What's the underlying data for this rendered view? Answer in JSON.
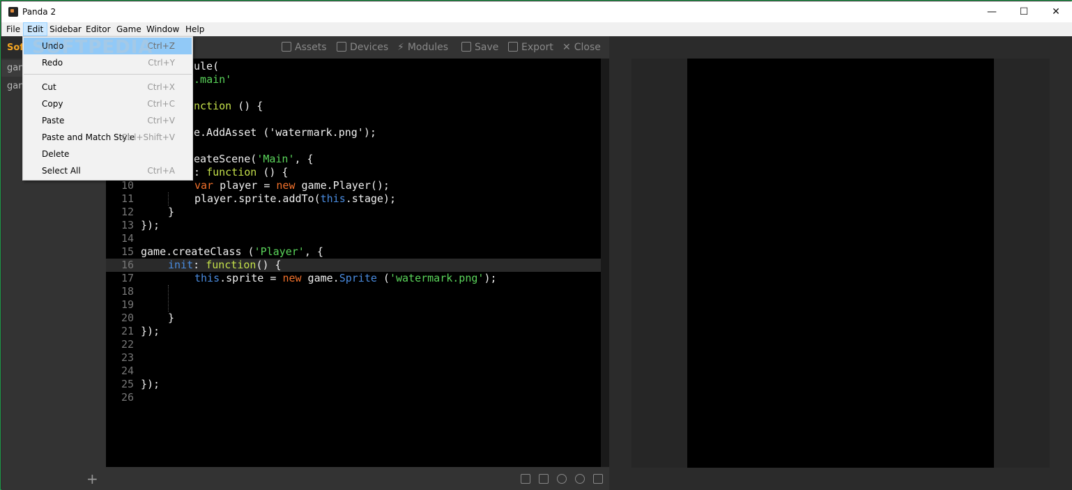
{
  "window": {
    "title": "Panda 2",
    "minimize": "—",
    "maximize": "☐",
    "close": "✕"
  },
  "menubar": {
    "items": [
      "File",
      "Edit",
      "Sidebar",
      "Editor",
      "Game",
      "Window",
      "Help"
    ]
  },
  "sidebar": {
    "title": "Sof",
    "items": [
      "gan",
      "gan"
    ],
    "add": "+"
  },
  "toolbar": {
    "assets": "Assets",
    "devices": "Devices",
    "modules": "Modules",
    "save": "Save",
    "export": "Export",
    "close": "Close"
  },
  "edit_menu": {
    "items": [
      {
        "label": "Undo",
        "shortcut": "Ctrl+Z"
      },
      {
        "label": "Redo",
        "shortcut": "Ctrl+Y"
      },
      {
        "label": "Cut",
        "shortcut": "Ctrl+X"
      },
      {
        "label": "Copy",
        "shortcut": "Ctrl+C"
      },
      {
        "label": "Paste",
        "shortcut": "Ctrl+V"
      },
      {
        "label": "Paste and Match Style",
        "shortcut": "Ctrl+Shift+V"
      },
      {
        "label": "Delete",
        "shortcut": ""
      },
      {
        "label": "Select All",
        "shortcut": "Ctrl+A"
      }
    ]
  },
  "code": {
    "l1": "ule(",
    "l2": "e.main'",
    "l4a": "nction",
    "l4b": "() {",
    "l6": "e.AddAsset ('watermark.png');",
    "l8a": "eateScene(",
    "l8b": "'Main'",
    "l8c": ", {",
    "l9a": ": ",
    "l9b": "function",
    "l9c": " () {",
    "l10a": "var",
    "l10b": " player = ",
    "l10c": "new",
    "l10d": " game.Player();",
    "l11a": "player.sprite.addTo(",
    "l11b": "this",
    "l11c": ".stage);",
    "l12": "}",
    "l13": "});",
    "l15a": "game.createClass (",
    "l15b": "'Player'",
    "l15c": ", {",
    "l16a": "init",
    "l16b": ": ",
    "l16c": "function",
    "l16d": "() {",
    "l17a": "this",
    "l17b": ".sprite = ",
    "l17c": "new",
    "l17d": " game.",
    "l17e": "Sprite",
    "l17f": " (",
    "l17g": "'watermark.png'",
    "l17h": ");",
    "l20": "}",
    "l21": "});",
    "l25": "});"
  },
  "line_numbers": [
    "10",
    "11",
    "12",
    "13",
    "14",
    "15",
    "16",
    "17",
    "18",
    "19",
    "20",
    "21",
    "22",
    "23",
    "24",
    "25",
    "26"
  ],
  "watermark": "SOFTPEDIA"
}
